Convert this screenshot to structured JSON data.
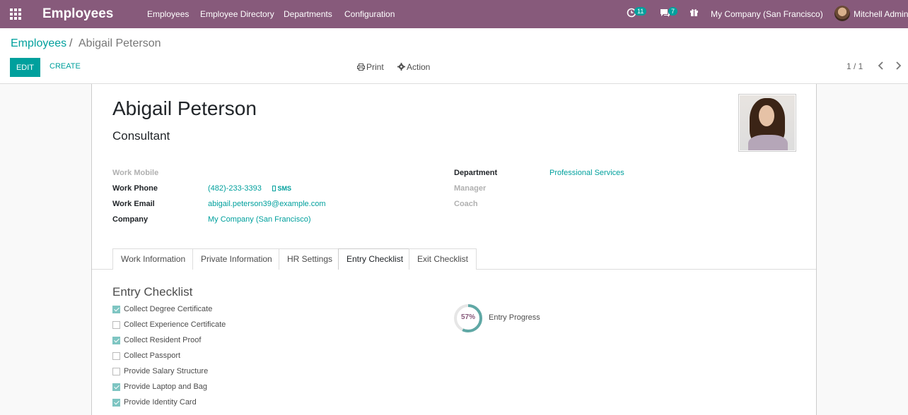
{
  "navbar": {
    "app_name": "Employees",
    "menu": [
      "Employees",
      "Employee Directory",
      "Departments",
      "Configuration"
    ],
    "activity_count": "11",
    "message_count": "7",
    "company": "My Company (San Francisco)",
    "user": "Mitchell Admin",
    "accent": "#875a7b"
  },
  "control": {
    "breadcrumb_root": "Employees",
    "breadcrumb_sep": "/",
    "breadcrumb_current": "Abigail Peterson",
    "edit_label": "EDIT",
    "create_label": "CREATE",
    "print_label": "Print",
    "action_label": "Action",
    "pager": "1 / 1"
  },
  "employee": {
    "name": "Abigail Peterson",
    "job_title": "Consultant",
    "fields_left": [
      {
        "label": "Work Mobile",
        "value": "",
        "muted": true
      },
      {
        "label": "Work Phone",
        "value": "(482)-233-3393",
        "sms": "SMS"
      },
      {
        "label": "Work Email",
        "value": "abigail.peterson39@example.com"
      },
      {
        "label": "Company",
        "value": "My Company (San Francisco)"
      }
    ],
    "fields_right": [
      {
        "label": "Department",
        "value": "Professional Services"
      },
      {
        "label": "Manager",
        "value": "",
        "muted": true
      },
      {
        "label": "Coach",
        "value": "",
        "muted": true
      }
    ]
  },
  "tabs": [
    {
      "label": "Work Information",
      "active": false
    },
    {
      "label": "Private Information",
      "active": false
    },
    {
      "label": "HR Settings",
      "active": false
    },
    {
      "label": "Entry Checklist",
      "active": true
    },
    {
      "label": "Exit Checklist",
      "active": false
    }
  ],
  "entry_checklist": {
    "title": "Entry Checklist",
    "items": [
      {
        "label": "Collect Degree Certificate",
        "checked": true
      },
      {
        "label": "Collect Experience Certificate",
        "checked": false
      },
      {
        "label": "Collect Resident Proof",
        "checked": true
      },
      {
        "label": "Collect Passport",
        "checked": false
      },
      {
        "label": "Provide Salary Structure",
        "checked": false
      },
      {
        "label": "Provide Laptop and Bag",
        "checked": true
      },
      {
        "label": "Provide Identity Card",
        "checked": true
      }
    ],
    "progress_value": 57,
    "progress_text": "57%",
    "progress_label": "Entry Progress"
  }
}
